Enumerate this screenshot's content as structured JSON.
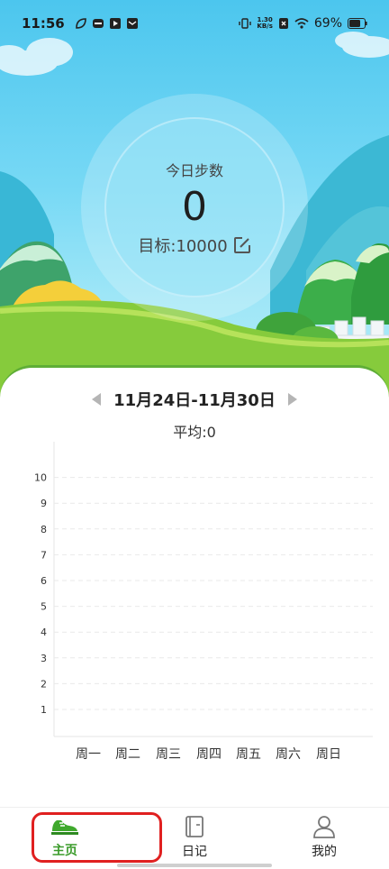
{
  "status_bar": {
    "time": "11:56",
    "speed_top": "1.30",
    "speed_bottom": "KB/s",
    "battery": "69%"
  },
  "steps": {
    "label": "今日步数",
    "count": "0",
    "goal_label": "目标:10000"
  },
  "week": {
    "range": "11月24日-11月30日",
    "average": "平均:0"
  },
  "chart_data": {
    "type": "bar",
    "categories": [
      "周一",
      "周二",
      "周三",
      "周四",
      "周五",
      "周六",
      "周日"
    ],
    "values": [
      0,
      0,
      0,
      0,
      0,
      0,
      0
    ],
    "y_ticks": [
      "1",
      "2",
      "3",
      "4",
      "5",
      "6",
      "7",
      "8",
      "9",
      "10"
    ],
    "ylim": [
      0,
      10
    ],
    "grid": true,
    "title": "",
    "xlabel": "",
    "ylabel": ""
  },
  "nav": {
    "home": "主页",
    "diary": "日记",
    "mine": "我的"
  },
  "colors": {
    "accent": "#3a9b2a",
    "sky": "#4cc6ee",
    "annotation": "#e02020"
  }
}
